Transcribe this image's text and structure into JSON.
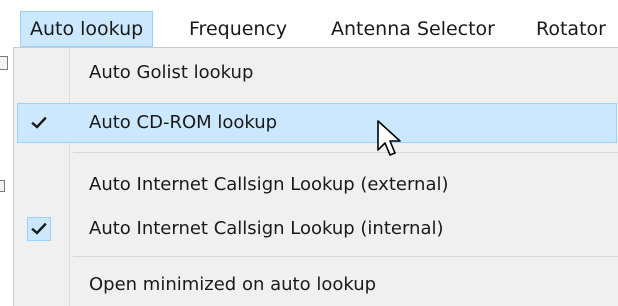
{
  "menubar": {
    "items": [
      "Auto lookup",
      "Frequency",
      "Antenna Selector",
      "Rotator"
    ]
  },
  "dropdown": {
    "items": [
      {
        "label": "Auto Golist lookup",
        "checked": false
      },
      {
        "label": "Auto CD-ROM lookup",
        "checked": true
      },
      {
        "label": "Auto Internet Callsign Lookup (external)",
        "checked": false
      },
      {
        "label": "Auto Internet Callsign Lookup (internal)",
        "checked": true
      },
      {
        "label": "Open minimized on auto lookup",
        "checked": false
      }
    ]
  },
  "icons": {
    "check": "check-icon",
    "cursor": "mouse-pointer-icon"
  },
  "colors": {
    "highlight": "#cce8ff",
    "highlight_border": "#99d1ff",
    "menu_bg": "#f0f0f0"
  }
}
